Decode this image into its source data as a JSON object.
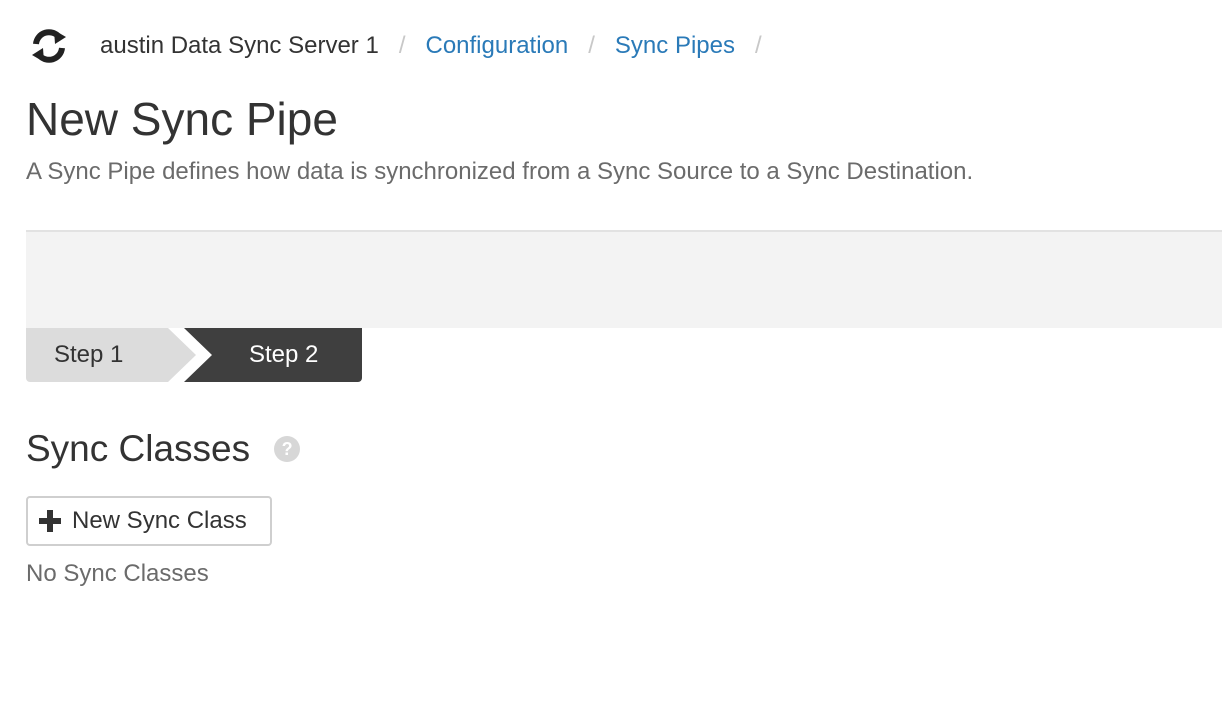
{
  "breadcrumb": {
    "logo_icon": "sync-icon",
    "server": "austin Data Sync Server 1",
    "separator": "/",
    "configuration": "Configuration",
    "sync_pipes": "Sync Pipes"
  },
  "page": {
    "title": "New Sync Pipe",
    "subtitle": "A Sync Pipe defines how data is synchronized from a Sync Source to a Sync Destination."
  },
  "steps": {
    "items": [
      {
        "label": "Step 1",
        "active": false
      },
      {
        "label": "Step 2",
        "active": true
      }
    ]
  },
  "sync_classes": {
    "title": "Sync Classes",
    "help_icon": "question-circle-icon",
    "help_glyph": "?",
    "new_button_label": "New Sync Class",
    "new_button_icon": "plus-icon",
    "empty_text": "No Sync Classes"
  },
  "colors": {
    "link": "#2a7ab8",
    "step_active": "#3f3f3f",
    "step_inactive": "#dcdcdc",
    "band": "#f3f3f3"
  }
}
